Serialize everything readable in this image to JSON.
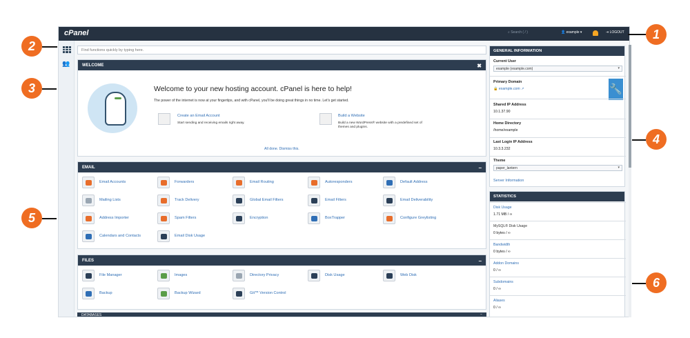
{
  "header": {
    "logo": "cPanel",
    "search_placeholder": "Search ( / )",
    "user": "example",
    "logout": "LOGOUT"
  },
  "quick_search": {
    "placeholder": "Find functions quickly by typing here."
  },
  "welcome": {
    "header": "WELCOME",
    "close": "✖",
    "title": "Welcome to your new hosting account. cPanel is here to help!",
    "text": "The power of the internet is now at your fingertips, and with cPanel, you'll be doing great things in no time. Let's get started.",
    "links": [
      {
        "title": "Create an Email Account",
        "description": "Start sending and receiving emails right away."
      },
      {
        "title": "Build a Website",
        "description": "Build a new WordPress® website with a predefined set of themes and plugins."
      }
    ],
    "dismiss": "All done. Dismiss this."
  },
  "email_panel": {
    "header": "EMAIL",
    "toggle": "−",
    "items": [
      {
        "label": "Email Accounts",
        "color": "#e86d2b"
      },
      {
        "label": "Forwarders",
        "color": "#e86d2b"
      },
      {
        "label": "Email Routing",
        "color": "#e86d2b"
      },
      {
        "label": "Autoresponders",
        "color": "#e86d2b"
      },
      {
        "label": "Default Address",
        "color": "#2f6eb5"
      },
      {
        "label": "Mailing Lists",
        "color": "#9aa6b2"
      },
      {
        "label": "Track Delivery",
        "color": "#e86d2b"
      },
      {
        "label": "Global Email Filters",
        "color": "#2b3f57"
      },
      {
        "label": "Email Filters",
        "color": "#2b3f57"
      },
      {
        "label": "Email Deliverability",
        "color": "#2b3f57"
      },
      {
        "label": "Address Importer",
        "color": "#e86d2b"
      },
      {
        "label": "Spam Filters",
        "color": "#e86d2b"
      },
      {
        "label": "Encryption",
        "color": "#2b3f57"
      },
      {
        "label": "BoxTrapper",
        "color": "#2f6eb5"
      },
      {
        "label": "Configure Greylisting",
        "color": "#e86d2b"
      },
      {
        "label": "Calendars and Contacts",
        "color": "#2f6eb5"
      },
      {
        "label": "Email Disk Usage",
        "color": "#2b3f57"
      }
    ]
  },
  "files_panel": {
    "header": "FILES",
    "toggle": "−",
    "items": [
      {
        "label": "File Manager",
        "color": "#2b3f57"
      },
      {
        "label": "Images",
        "color": "#5a9d48"
      },
      {
        "label": "Directory Privacy",
        "color": "#9aa6b2"
      },
      {
        "label": "Disk Usage",
        "color": "#2b3f57"
      },
      {
        "label": "Web Disk",
        "color": "#2b3f57"
      },
      {
        "label": "Backup",
        "color": "#2f6eb5"
      },
      {
        "label": "Backup Wizard",
        "color": "#5a9d48"
      },
      {
        "label": "Git™ Version Control",
        "color": "#2b3f57"
      }
    ]
  },
  "databases_panel": {
    "header": "DATABASES",
    "toggle": "−"
  },
  "general_info": {
    "header": "GENERAL INFORMATION",
    "current_user_label": "Current User",
    "current_user_value": "example (example.com)",
    "primary_domain_label": "Primary Domain",
    "primary_domain_value": "example.com",
    "shared_ip_label": "Shared IP Address",
    "shared_ip_value": "10.1.37.90",
    "home_dir_label": "Home Directory",
    "home_dir_value": "/home/example",
    "last_login_label": "Last Login IP Address",
    "last_login_value": "10.3.3.232",
    "theme_label": "Theme",
    "theme_value": "paper_lantern",
    "server_info": "Server Information"
  },
  "statistics": {
    "header": "STATISTICS",
    "rows": [
      {
        "label": "Disk Usage",
        "value": "1.71 MB / ∞"
      },
      {
        "label": "MySQL® Disk Usage",
        "value": "0 bytes / ∞"
      },
      {
        "label": "Bandwidth",
        "value": "0 bytes / ∞"
      },
      {
        "label": "Addon Domains",
        "value": "0 / ∞"
      },
      {
        "label": "Subdomains",
        "value": "0 / ∞"
      },
      {
        "label": "Aliases",
        "value": "0 / ∞"
      }
    ]
  },
  "callouts": [
    "1",
    "2",
    "3",
    "4",
    "5",
    "6"
  ]
}
